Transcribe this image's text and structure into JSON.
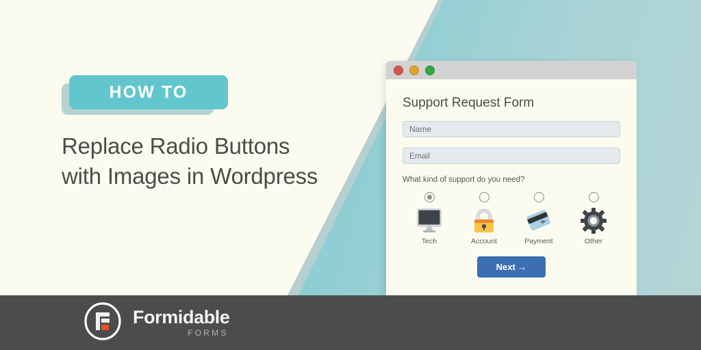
{
  "hero": {
    "badge_label": "HOW TO",
    "headline_line1": "Replace Radio Buttons",
    "headline_line2": "with Images in Wordpress"
  },
  "window": {
    "traffic_lights": [
      "close-red",
      "minimize-yellow",
      "zoom-green"
    ],
    "form": {
      "title": "Support Request Form",
      "fields": [
        {
          "name": "name",
          "placeholder": "Name",
          "value": ""
        },
        {
          "name": "email",
          "placeholder": "Email",
          "value": ""
        }
      ],
      "question": "What kind of support do you need?",
      "options": [
        {
          "label": "Tech",
          "icon": "monitor-icon",
          "checked": true
        },
        {
          "label": "Account",
          "icon": "lock-icon",
          "checked": false
        },
        {
          "label": "Payment",
          "icon": "credit-card-icon",
          "checked": false
        },
        {
          "label": "Other",
          "icon": "gear-icon",
          "checked": false
        }
      ],
      "submit_label": "Next →"
    }
  },
  "footer": {
    "brand_name": "Formidable",
    "brand_sub": "FORMS",
    "logo_icon": "formidable-f-logo-icon"
  },
  "colors": {
    "background_cream": "#fbfbef",
    "teal": "#5cc4cd",
    "teal_muted": "#b6cfd0",
    "badge_teal": "#62c6ce",
    "badge_shadow": "#b5d3d2",
    "headline_gray": "#4c4c4c",
    "footer_gray": "#4c4c4c",
    "button_blue": "#3c6eb4",
    "accent_orange": "#e8502a",
    "field_fill": "#e4eaee"
  }
}
